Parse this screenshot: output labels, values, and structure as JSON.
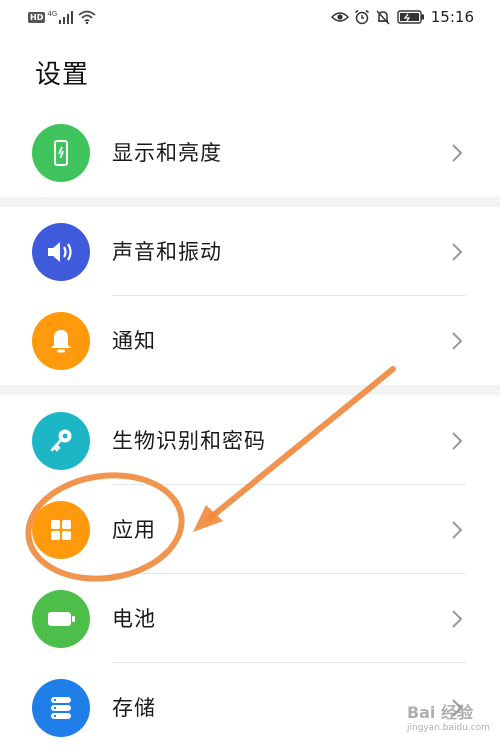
{
  "statusbar": {
    "hd_badge": "HD",
    "network": "4G",
    "time": "15:16"
  },
  "page": {
    "title": "设置"
  },
  "items": [
    {
      "label": "显示和亮度",
      "icon": "display-phone-icon",
      "color": "#3fc35c"
    },
    {
      "label": "声音和振动",
      "icon": "speaker-icon",
      "color": "#3f5bdc"
    },
    {
      "label": "通知",
      "icon": "bell-icon",
      "color": "#ff9a0d"
    },
    {
      "label": "生物识别和密码",
      "icon": "key-icon",
      "color": "#1db6c6"
    },
    {
      "label": "应用",
      "icon": "apps-grid-icon",
      "color": "#ff9a0d"
    },
    {
      "label": "电池",
      "icon": "battery-icon",
      "color": "#4dbe4a"
    },
    {
      "label": "存储",
      "icon": "storage-icon",
      "color": "#1f7ee8"
    }
  ],
  "annotation": {
    "color": "#f0883a"
  },
  "watermark": {
    "text": "Bai 经验",
    "subtext": "jingyan.baidu.com"
  }
}
